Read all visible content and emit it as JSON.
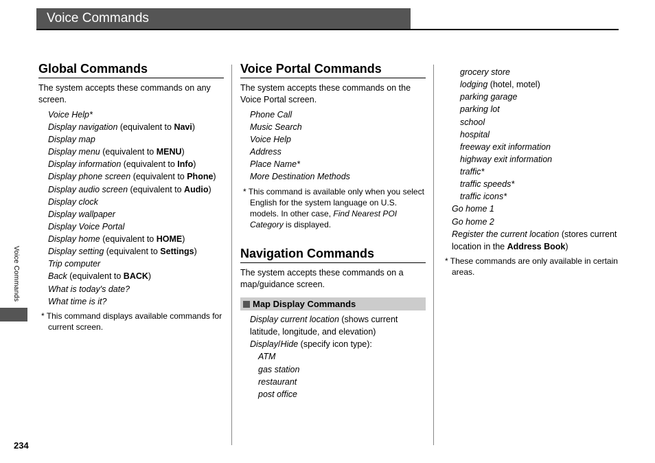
{
  "page_title": "Voice Commands",
  "side_tab": "Voice Commands",
  "page_number": "234",
  "col1": {
    "h_global": "Global Commands",
    "intro_global": "The system accepts these commands on any screen.",
    "g1_a": "Voice Help*",
    "g2_a": "Display navigation",
    "g2_b": " (equivalent to ",
    "g2_c": "Navi",
    "g2_d": ")",
    "g3_a": "Display map",
    "g4_a": "Display menu",
    "g4_b": " (equivalent to ",
    "g4_c": "MENU",
    "g4_d": ")",
    "g5_a": "Display information",
    "g5_b": " (equivalent to ",
    "g5_c": "Info",
    "g5_d": ")",
    "g6_a": "Display phone screen",
    "g6_b": " (equivalent to ",
    "g6_c": "Phone",
    "g6_d": ")",
    "g7_a": "Display audio screen",
    "g7_b": " (equivalent to ",
    "g7_c": "Audio",
    "g7_d": ")",
    "g8_a": "Display clock",
    "g9_a": "Display wallpaper",
    "g10_a": "Display Voice Portal",
    "g11_a": "Display home",
    "g11_b": " (equivalent to ",
    "g11_c": "HOME",
    "g11_d": ")",
    "g12_a": "Display setting",
    "g12_b": " (equivalent to ",
    "g12_c": "Settings",
    "g12_d": ")",
    "g13_a": "Trip computer",
    "g14_a": "Back",
    "g14_b": " (equivalent to ",
    "g14_c": "BACK",
    "g14_d": ")",
    "g15_a": "What is today's date?",
    "g16_a": "What time is it?",
    "note_global": "*  This command displays available commands for current screen."
  },
  "col2": {
    "h_voice_portal": "Voice Portal Commands",
    "intro_voice_portal": "The system accepts these commands on the Voice Portal screen.",
    "v1": "Phone Call",
    "v2": "Music Search",
    "v3": "Voice Help",
    "v4": "Address",
    "v5": "Place Name*",
    "v6": "More Destination Methods",
    "note_vp_a": "*  This command is available only when you select English for the system language on U.S. models. In other case, ",
    "note_vp_b": "Find Nearest POI Category",
    "note_vp_c": " is displayed.",
    "h_nav": "Navigation Commands",
    "intro_nav": "The system accepts these commands on a map/guidance screen.",
    "h_map_display": "Map Display Commands",
    "m1_a": "Display current location",
    "m1_b": " (shows current latitude, longitude, and elevation)",
    "m2_a": "Display",
    "m2_b": "/",
    "m2_c": "Hide",
    "m2_d": " (specify icon type):",
    "s1": "ATM",
    "s2": "gas station",
    "s3": "restaurant",
    "s4": "post office"
  },
  "col3": {
    "s5": "grocery store",
    "s6_a": "lodging",
    "s6_b": " (hotel, motel)",
    "s7": "parking garage",
    "s8": "parking lot",
    "s9": "school",
    "s10": "hospital",
    "s11": "freeway exit information",
    "s12": "highway exit information",
    "s13": "traffic*",
    "s14": "traffic speeds*",
    "s15": "traffic icons*",
    "m3": "Go home 1",
    "m4": "Go home 2",
    "m5_a": "Register the current location",
    "m5_b": " (stores current location in the ",
    "m5_c": "Address Book",
    "m5_d": ")",
    "note_nav": "*  These commands are only available in certain areas."
  }
}
